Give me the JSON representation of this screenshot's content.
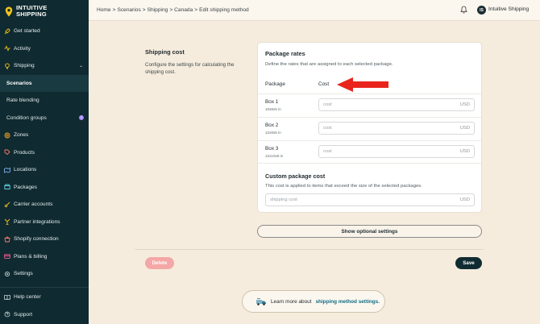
{
  "brand": {
    "line1": "INTUITIVE",
    "line2": "SHIPPING"
  },
  "sidebar": {
    "items": [
      {
        "label": "Get started",
        "icon": "rocket-icon"
      },
      {
        "label": "Activity",
        "icon": "activity-icon"
      },
      {
        "label": "Shipping",
        "icon": "lightbulb-icon"
      }
    ],
    "sub": [
      {
        "label": "Scenarios"
      },
      {
        "label": "Rate blending"
      },
      {
        "label": "Condition groups",
        "badge": "i"
      }
    ],
    "items2": [
      {
        "label": "Zones",
        "icon": "zones-icon"
      },
      {
        "label": "Products",
        "icon": "tag-icon"
      },
      {
        "label": "Locations",
        "icon": "location-icon"
      },
      {
        "label": "Packages",
        "icon": "package-icon"
      },
      {
        "label": "Carrier accounts",
        "icon": "carrier-icon"
      },
      {
        "label": "Partner integrations",
        "icon": "partner-icon"
      },
      {
        "label": "Shopify connection",
        "icon": "shopify-icon"
      },
      {
        "label": "Plans & billing",
        "icon": "billing-icon"
      },
      {
        "label": "Settings",
        "icon": "gear-icon"
      }
    ],
    "bottom": [
      {
        "label": "Help center",
        "icon": "book-icon"
      },
      {
        "label": "Support",
        "icon": "help-icon"
      }
    ]
  },
  "breadcrumb": [
    "Home",
    ">",
    "Scenarios",
    ">",
    "Shipping",
    ">",
    "Canada",
    ">",
    "Edit shipping method"
  ],
  "user": {
    "initials": "IS",
    "name": "Intuitive Shipping"
  },
  "section": {
    "title": "Shipping cost",
    "description": "Configure the settings for calculating the shipping cost."
  },
  "rates": {
    "title": "Package rates",
    "description": "Define the rates that are assigned to each selected package.",
    "col_package": "Package",
    "col_cost": "Cost",
    "rows": [
      {
        "name": "Box 1",
        "size": "10x8x5 in",
        "placeholder": "cost",
        "currency": "USD"
      },
      {
        "name": "Box 2",
        "size": "12x8x5 in",
        "placeholder": "cost",
        "currency": "USD"
      },
      {
        "name": "Box 3",
        "size": "12x10x6 in",
        "placeholder": "cost",
        "currency": "USD"
      }
    ]
  },
  "custom": {
    "title": "Custom package cost",
    "description": "This cost is applied to items that exceed the size of the selected packages.",
    "placeholder": "shipping cost",
    "currency": "USD"
  },
  "buttons": {
    "optional": "Show optional settings",
    "delete": "Delete",
    "save": "Save"
  },
  "learn": {
    "prefix": "Learn more about",
    "link": "shipping method settings."
  },
  "colors": {
    "sidebar": "#0f2a30",
    "page": "#f6ecdd",
    "arrow": "#e8241c",
    "save": "#102c32",
    "delete": "#f4a7a7"
  }
}
